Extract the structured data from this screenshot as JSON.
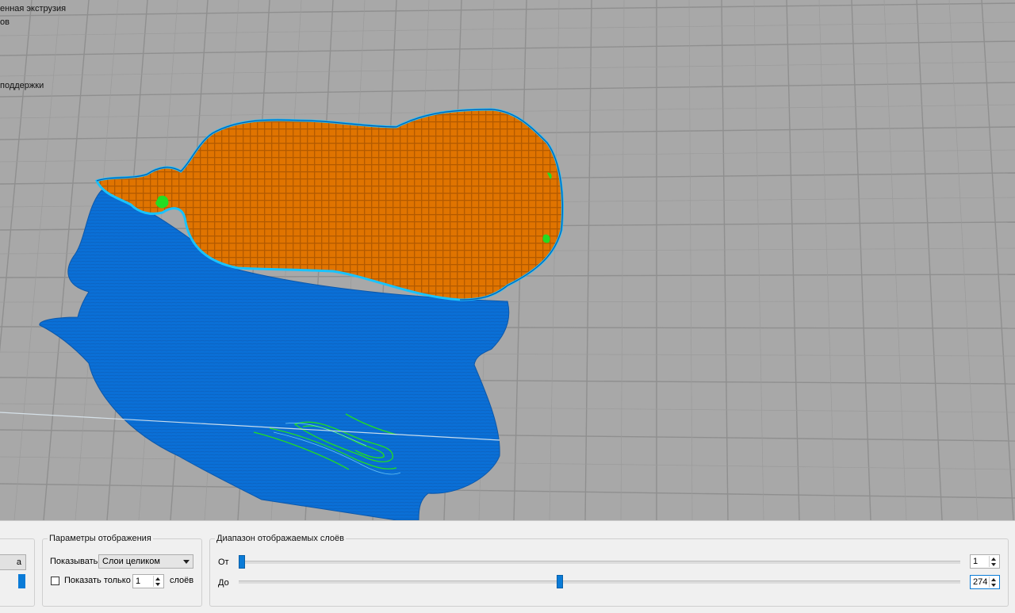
{
  "legend": {
    "lines": [
      "енная экструзия",
      "ов",
      "поддержки"
    ]
  },
  "panel": {
    "left_group": {
      "button_label": "а"
    },
    "display_params": {
      "title": "Параметры отображения",
      "show_label": "Показывать",
      "show_value": "Слои целиком",
      "only_label": "Показать только",
      "only_value": "1",
      "layers_suffix": "слоёв",
      "only_checked": false
    },
    "layer_range": {
      "title": "Диапазон отображаемых слоёв",
      "from_label": "От",
      "from_value": "1",
      "to_label": "До",
      "to_value": "274",
      "total_layers": 274
    }
  },
  "colors": {
    "viewport_bg": "#a8a8a8",
    "grid_line": "#8e8e8e",
    "shell_blue": "#0a6fd6",
    "infill_orange": "#e07400",
    "support_green": "#22dd22",
    "accent": "#0a7bd7"
  }
}
